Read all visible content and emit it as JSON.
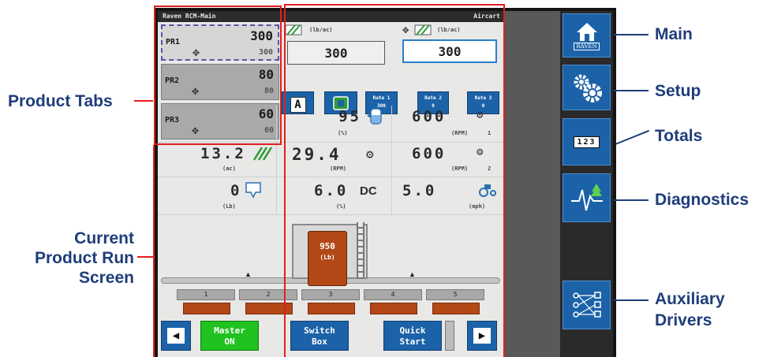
{
  "callouts": {
    "product_tabs": "Product Tabs",
    "current_run_line1": "Current",
    "current_run_line2": "Product Run",
    "current_run_line3": "Screen",
    "main": "Main",
    "setup": "Setup",
    "totals": "Totals",
    "diagnostics": "Diagnostics",
    "auxiliary_line1": "Auxiliary",
    "auxiliary_line2": "Drivers"
  },
  "topbar": {
    "left": "Raven RCM-Main",
    "right": "Aircart"
  },
  "product_tabs": [
    {
      "name": "PR1",
      "rate": "300",
      "target": "300",
      "active": true
    },
    {
      "name": "PR2",
      "rate": "80",
      "target": "80",
      "active": false
    },
    {
      "name": "PR3",
      "rate": "60",
      "target": "60",
      "active": false
    }
  ],
  "rate_header": {
    "left_unit": "(lb/ac)",
    "right_unit": "(lb/ac)"
  },
  "rate_boxes": {
    "left": "300",
    "right": "300"
  },
  "mode_buttons": {
    "auto": "A",
    "rate1": {
      "line1": "Rate 1",
      "line2": "300"
    },
    "rate2": {
      "line1": "Rate 2",
      "line2": "0"
    },
    "rate3": {
      "line1": "Rate 3",
      "line2": "0"
    }
  },
  "readouts": {
    "tank_level": {
      "value": "95",
      "unit": "(%)"
    },
    "fan1": {
      "value": "600",
      "unit": "(RPM)",
      "index": "1"
    },
    "area": {
      "value": "13.2",
      "unit": "(ac)"
    },
    "shaft": {
      "value": "29.4",
      "unit": "(RPM)"
    },
    "fan2": {
      "value": "600",
      "unit": "(RPM)",
      "index": "2"
    },
    "product_weight": {
      "value": "0",
      "unit": "(Lb)"
    },
    "duty_cycle": {
      "value": "6.0",
      "suffix": "DC",
      "unit": "(%)"
    },
    "speed": {
      "value": "5.0",
      "unit": "(mph)"
    }
  },
  "tank": {
    "value": "950",
    "unit": "(Lb)"
  },
  "sections": [
    "1",
    "2",
    "3",
    "4",
    "5"
  ],
  "bottom_buttons": {
    "master": {
      "line1": "Master",
      "line2": "ON"
    },
    "switch_box": {
      "line1": "Switch",
      "line2": "Box"
    },
    "quick_start": {
      "line1": "Quick",
      "line2": "Start"
    }
  },
  "sidebar": {
    "brand": "RAVEN",
    "totals_label": "123"
  },
  "colors": {
    "callout_text": "#1f3d7a",
    "highlight_box": "#e0201e",
    "sidebar_button": "#1b62a8",
    "master_on": "#1fc21f",
    "section_bar": "#b34716"
  }
}
